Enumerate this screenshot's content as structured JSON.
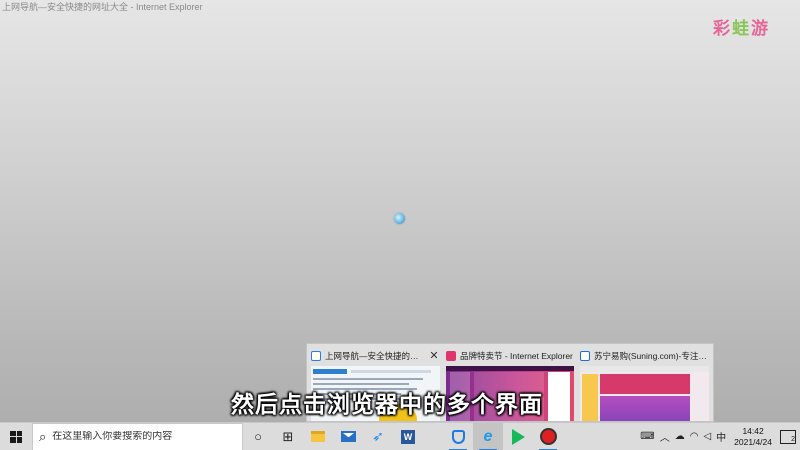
{
  "window": {
    "title": "上网导航—安全快捷的网址大全 - Internet Explorer"
  },
  "watermark": {
    "logo_left": "彩",
    "logo_mid": "蛙",
    "logo_right": "游"
  },
  "loading": {
    "icon": "ie-loading-spinner-icon"
  },
  "thumbnails": [
    {
      "title": "上网导航—安全快捷的网...",
      "favicon": "nav-favicon-icon",
      "close": "✕"
    },
    {
      "title": "品牌特卖节 - Internet Explorer",
      "favicon": "brand-sale-favicon-icon"
    },
    {
      "title": "苏宁易购(Suning.com)-专注好...",
      "favicon": "suning-favicon-icon"
    }
  ],
  "subtitle": "然后点击浏览器中的多个界面",
  "taskbar": {
    "search_placeholder": "在这里输入你要搜索的内容",
    "search_icon": "⌕",
    "cortana_icon": "○",
    "taskview_icon": "⊞",
    "ie_label": "e",
    "word_label": "W",
    "keyboard_label": "⌨",
    "tray": {
      "chevron": "︿",
      "cloud": "☁",
      "wifi": "◠",
      "volume": "◁",
      "ime": "中"
    },
    "clock": {
      "time": "14:42",
      "date": "2021/4/24"
    },
    "notifications": "2"
  }
}
